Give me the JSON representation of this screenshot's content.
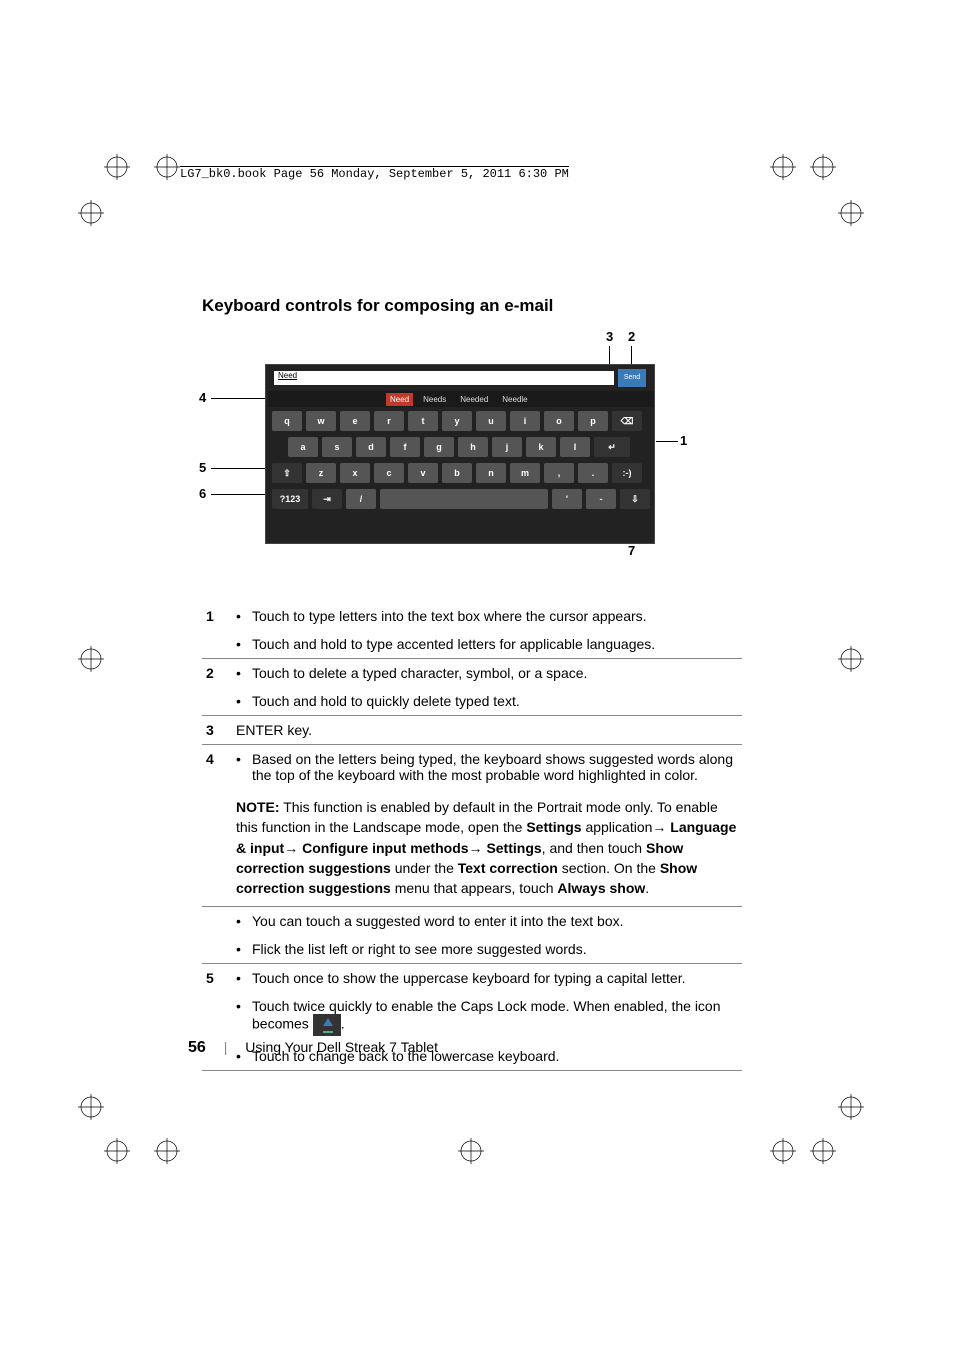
{
  "header_imprint": "LG7_bk0.book  Page 56  Monday, September 5, 2011  6:30 PM",
  "section_title": "Keyboard controls for composing an e-mail",
  "keyboard": {
    "textfield_value": "Need",
    "send_label": "Send",
    "suggestions": [
      "Need",
      "Needs",
      "Needed",
      "Needle"
    ],
    "row1": [
      "q",
      "w",
      "e",
      "r",
      "t",
      "y",
      "u",
      "i",
      "o",
      "p",
      "⌫"
    ],
    "row2": [
      "a",
      "s",
      "d",
      "f",
      "g",
      "h",
      "j",
      "k",
      "l",
      "↵"
    ],
    "row3": [
      "⇧",
      "z",
      "x",
      "c",
      "v",
      "b",
      "n",
      "m",
      ",",
      ".",
      ":-)"
    ],
    "row4": [
      "?123",
      "⇥",
      "/",
      "",
      "'",
      "-",
      "⇩"
    ]
  },
  "callouts": {
    "c1": "1",
    "c2": "2",
    "c3": "3",
    "c4": "4",
    "c5": "5",
    "c6": "6",
    "c7": "7"
  },
  "table": {
    "r1a": "Touch to type letters into the text box where the cursor appears.",
    "r1b": "Touch and hold to type accented letters for applicable languages.",
    "r2a": "Touch to delete a typed character, symbol, or a space.",
    "r2b": "Touch and hold to quickly delete typed text.",
    "r3": "ENTER key.",
    "r4": "Based on the letters being typed, the keyboard shows suggested words along the top of the keyboard with the most probable word highlighted in color.",
    "r4_extra1": "You can touch a suggested word to enter it into the text box.",
    "r4_extra2": "Flick the list left or right to see more suggested words.",
    "r5a": "Touch once to show the uppercase keyboard for typing a capital letter.",
    "r5b_pre": "Touch twice quickly to enable the Caps Lock mode. When enabled, the icon becomes ",
    "r5b_post": ".",
    "r5c": "Touch to change back to the lowercase keyboard."
  },
  "note": {
    "label": "NOTE:",
    "t1": " This function is enabled by default in the Portrait mode only. To enable this function in the Landscape mode, open the ",
    "b1": "Settings",
    "t2": " application",
    "arrow": "→ ",
    "b2": "Language & input",
    "b3": "Configure input methods",
    "b4": "Settings",
    "t5": ", and then touch ",
    "b5": "Show correction suggestions",
    "t6": " under the ",
    "b6": "Text correction",
    "t7": " section. On the ",
    "b7": "Show correction suggestions",
    "t8": " menu that appears, touch ",
    "b8": "Always show",
    "t9": "."
  },
  "footer": {
    "page": "56",
    "chapter": "Using Your Dell Streak 7 Tablet"
  }
}
